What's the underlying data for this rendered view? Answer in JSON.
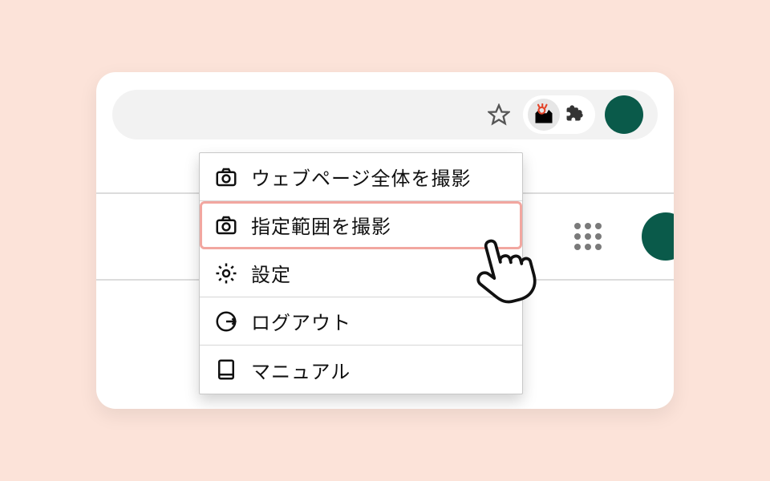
{
  "menu": {
    "items": [
      {
        "id": "capture-full-page",
        "label": "ウェブページ全体を撮影",
        "icon": "camera-icon",
        "highlight": false
      },
      {
        "id": "capture-area",
        "label": "指定範囲を撮影",
        "icon": "camera-icon",
        "highlight": true
      },
      {
        "id": "settings",
        "label": "設定",
        "icon": "gear-icon",
        "highlight": false
      },
      {
        "id": "logout",
        "label": "ログアウト",
        "icon": "logout-icon",
        "highlight": false
      },
      {
        "id": "manual",
        "label": "マニュアル",
        "icon": "book-icon",
        "highlight": false
      }
    ]
  },
  "toolbar": {
    "star_title": "このページをブックマーク",
    "extension_title": "拡張機能",
    "puzzle_title": "拡張機能一覧"
  },
  "colors": {
    "background": "#fce3d9",
    "highlight_border": "#f2a7a0",
    "avatar": "#0a5a4a"
  }
}
